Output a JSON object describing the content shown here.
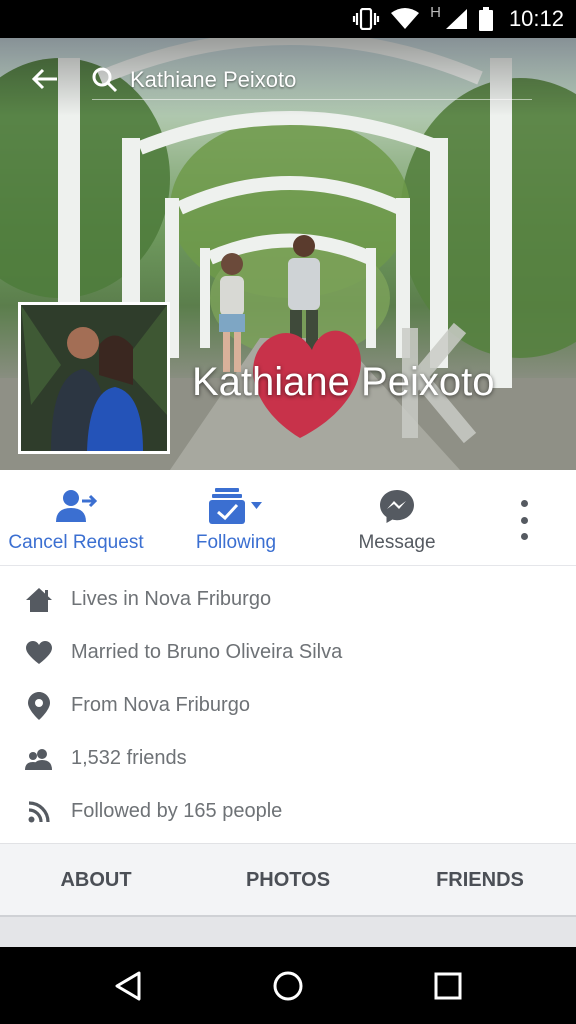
{
  "status_bar": {
    "time": "10:12",
    "network_letter": "H",
    "icons": [
      "vibrate-icon",
      "wifi-icon",
      "signal-icon",
      "battery-icon"
    ]
  },
  "header": {
    "search_text": "Kathiane Peixoto",
    "icons": [
      "back-arrow-icon",
      "search-icon"
    ]
  },
  "profile": {
    "name": "Kathiane Peixoto"
  },
  "actions": {
    "cancel_request": "Cancel Request",
    "following": "Following",
    "message": "Message",
    "icons": [
      "cancel-request-icon",
      "following-icon",
      "messenger-icon",
      "more-icon"
    ]
  },
  "info": [
    {
      "icon": "home-icon",
      "text": "Lives in Nova Friburgo"
    },
    {
      "icon": "heart-icon",
      "text": "Married to Bruno Oliveira Silva"
    },
    {
      "icon": "location-pin-icon",
      "text": "From Nova Friburgo"
    },
    {
      "icon": "friends-icon",
      "text": "1,532 friends"
    },
    {
      "icon": "rss-icon",
      "text": "Followed by 165 people"
    }
  ],
  "tabs": {
    "about": "ABOUT",
    "photos": "PHOTOS",
    "friends": "FRIENDS"
  },
  "nav_bar": {
    "icons": [
      "back-triangle-icon",
      "home-circle-icon",
      "recents-square-icon"
    ]
  },
  "colors": {
    "accent": "#3b6fd1",
    "text_secondary": "#6e7276",
    "icon_gray": "#555a61"
  }
}
